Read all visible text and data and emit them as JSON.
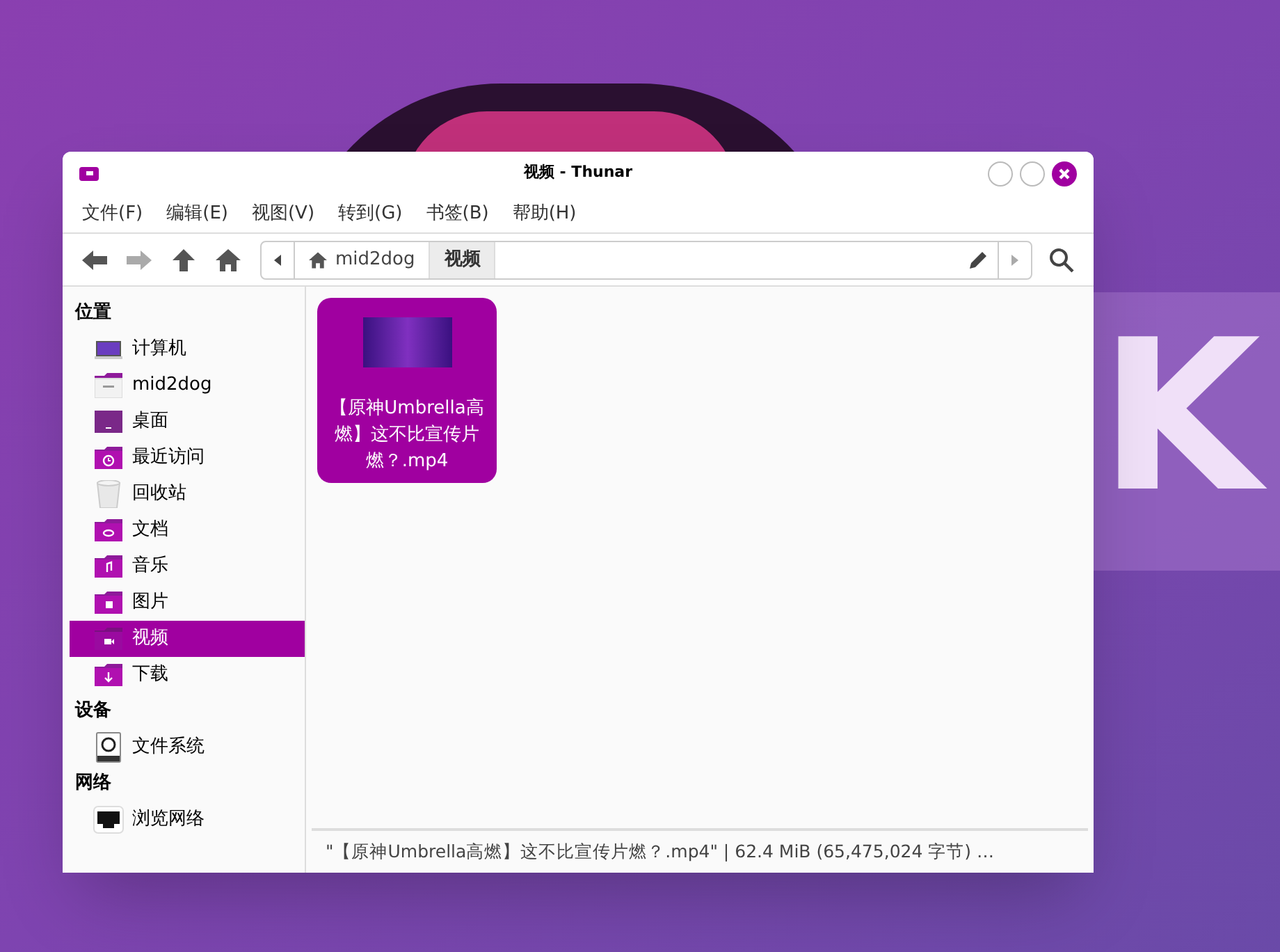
{
  "wallpaper": {
    "text": "K"
  },
  "window": {
    "title": "视频 - Thunar"
  },
  "menu": [
    "文件(F)",
    "编辑(E)",
    "视图(V)",
    "转到(G)",
    "书签(B)",
    "帮助(H)"
  ],
  "toolbar": {
    "back_disabled": false,
    "forward_disabled": true
  },
  "path": [
    {
      "label": "mid2dog",
      "kind": "home",
      "selected": false
    },
    {
      "label": "视频",
      "kind": "folder",
      "selected": true
    }
  ],
  "sidebar": [
    {
      "heading": "位置",
      "items": [
        {
          "label": "计算机",
          "kind": "computer",
          "selected": false
        },
        {
          "label": "mid2dog",
          "kind": "home",
          "selected": false
        },
        {
          "label": "桌面",
          "kind": "desktop",
          "selected": false
        },
        {
          "label": "最近访问",
          "kind": "recent",
          "selected": false
        },
        {
          "label": "回收站",
          "kind": "trash",
          "selected": false
        },
        {
          "label": "文档",
          "kind": "documents",
          "selected": false
        },
        {
          "label": "音乐",
          "kind": "music",
          "selected": false
        },
        {
          "label": "图片",
          "kind": "pictures",
          "selected": false
        },
        {
          "label": "视频",
          "kind": "videos",
          "selected": true
        },
        {
          "label": "下载",
          "kind": "downloads",
          "selected": false
        }
      ]
    },
    {
      "heading": "设备",
      "items": [
        {
          "label": "文件系统",
          "kind": "drive",
          "selected": false
        }
      ]
    },
    {
      "heading": "网络",
      "items": [
        {
          "label": "浏览网络",
          "kind": "network",
          "selected": false
        }
      ]
    }
  ],
  "files": [
    {
      "name": "【原神Umbrella高燃】这不比宣传片燃？.mp4",
      "selected": true
    }
  ],
  "status_bar": "\"【原神Umbrella高燃】这不比宣传片燃？.mp4\" | 62.4 MiB (65,475,024 字节) …"
}
